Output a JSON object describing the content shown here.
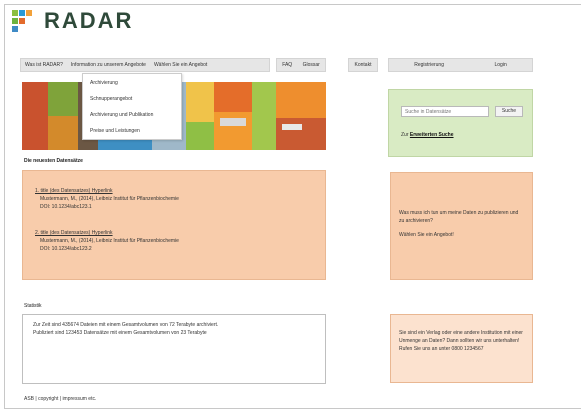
{
  "logo": {
    "text": "RADAR",
    "colors": [
      "#8cbf3f",
      "#2a9ad6",
      "#f2a13a",
      "#6db33f",
      "#e36b2c",
      "#3f8bc6"
    ]
  },
  "nav": {
    "main": [
      "Was ist RADAR?",
      "Information zu unserem Angebote",
      "Wählen Sie ein Angebot"
    ],
    "faq": "FAQ",
    "glossar": "Glossar",
    "kontakt": "Kontakt",
    "registrierung": "Registrierung",
    "login": "Login"
  },
  "dropdown": [
    "Archivierung",
    "Schnupperangebot",
    "Archivierung und Publikation",
    "Preise und Leistungen"
  ],
  "search": {
    "placeholder": "Suche in Datensätze",
    "button": "Suche",
    "advanced_prefix": "Zur",
    "advanced_link": "Erweiterten Suche"
  },
  "datasets": {
    "heading": "Die neuesten Datensätze",
    "items": [
      {
        "title": "1. title (des Datensatzes) Hyperlink",
        "authors": "Mustermann, M., (2014), Leibniz Institut für Pflanzenbiochemie",
        "doi": "DOI: 10.1234/abc123.1"
      },
      {
        "title": "2. title (des Datensatzes) Hyperlink",
        "authors": "Mustermann, M., (2014), Leibniz Institut für Pflanzenbiochemie",
        "doi": "DOI: 10.1234/abc123.2"
      }
    ]
  },
  "info1": {
    "question": "Was muss ich tun um meine Daten zu publizieren und zu archivieren?",
    "answer": "Wählen Sie ein Angebot!"
  },
  "stats": {
    "heading": "Statistik",
    "line1": "Zur Zeit sind 435674 Dateien mit einem Gesamtvolumen von 72 Terabyte archiviert.",
    "line2": "Publiziert sind 123453 Datensätze mit einem Gesamtvolumen von 23 Terabyte"
  },
  "info2": {
    "text": "Sie sind ein Verlag oder eine andere Institution mit einer Unmenge an Daten? Dann sollten wir uns unterhalten! Rufen Sie uns an unter 0800 1234567"
  },
  "footer": "ASB | copyright | impressum etc."
}
